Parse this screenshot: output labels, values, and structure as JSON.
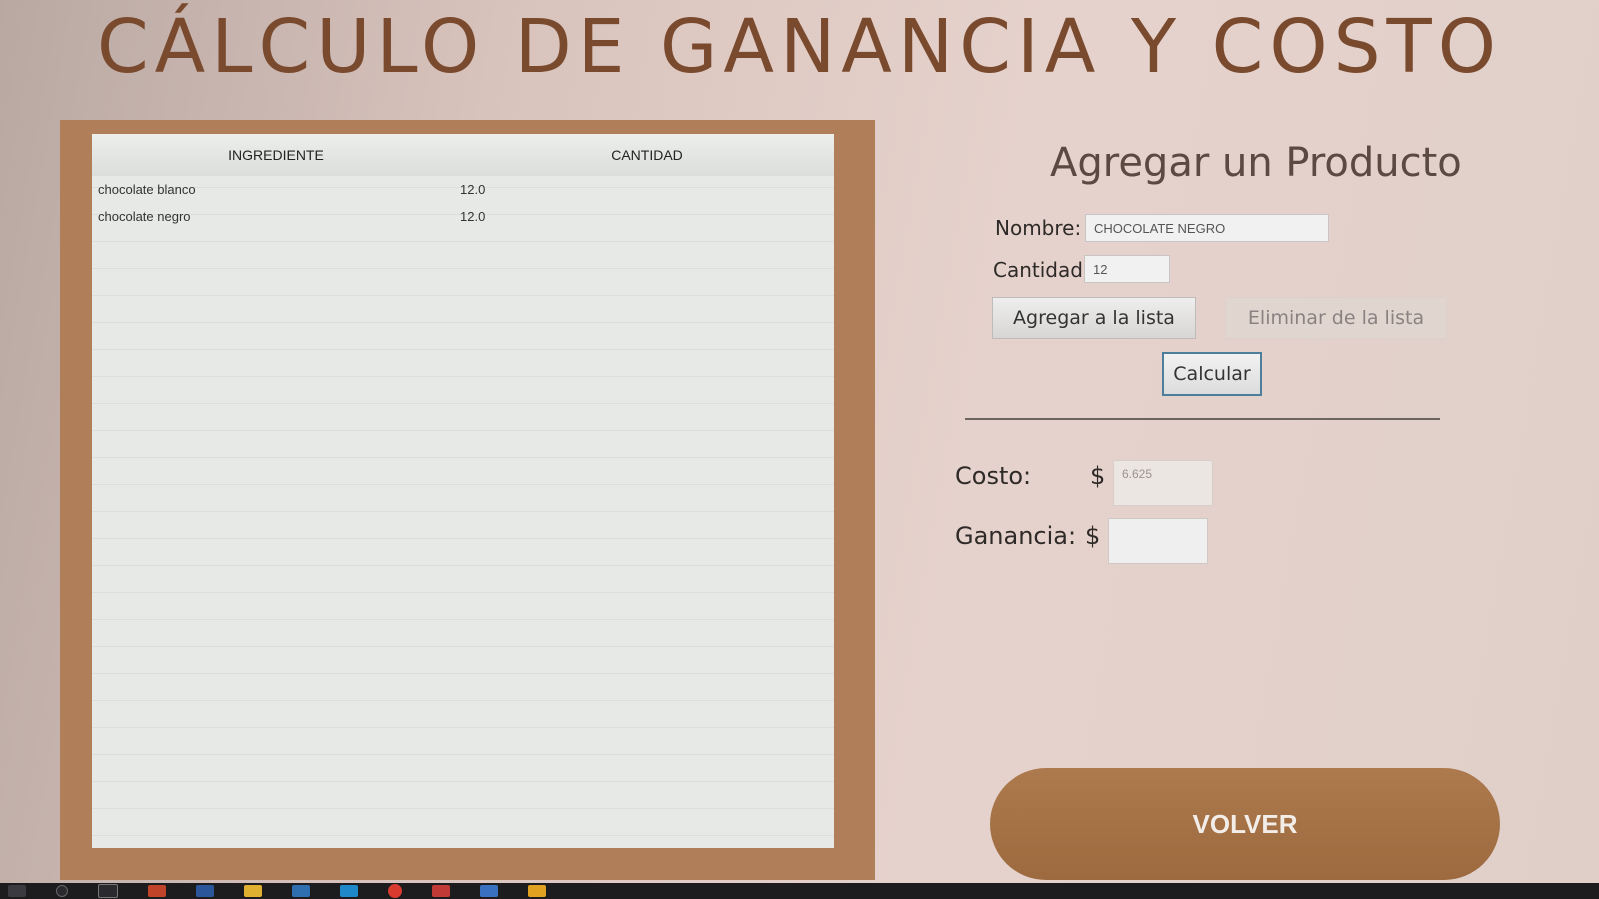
{
  "title": "CÁLCULO DE GANANCIA Y COSTO",
  "table": {
    "headers": [
      "INGREDIENTE",
      "CANTIDAD"
    ],
    "rows": [
      {
        "ingrediente": "chocolate blanco",
        "cantidad": "12.0"
      },
      {
        "ingrediente": "chocolate negro",
        "cantidad": "12.0"
      }
    ]
  },
  "form": {
    "heading": "Agregar un Producto",
    "nombre_label": "Nombre:",
    "nombre_value": "CHOCOLATE NEGRO",
    "cantidad_label": "Cantidad:",
    "cantidad_value": "12",
    "add_button": "Agregar a la lista",
    "remove_button": "Eliminar de la lista",
    "calc_button": "Calcular"
  },
  "results": {
    "costo_label": "Costo:",
    "currency": "$",
    "costo_value": "6.625",
    "ganancia_label": "Ganancia:",
    "ganancia_value": ""
  },
  "volver_button": "VOLVER",
  "taskbar_icons": [
    "windows-start-icon",
    "search-icon",
    "task-view-icon",
    "powerpoint-icon",
    "word-icon",
    "file-explorer-icon",
    "mail-icon",
    "app-icon",
    "chrome-icon",
    "app-icon-2",
    "app-icon-3",
    "app-icon-4"
  ],
  "colors": {
    "title": "#7a4a2e",
    "frame": "#b07e58",
    "volver": "#a8754a",
    "calc_border": "#4d7f9a"
  }
}
